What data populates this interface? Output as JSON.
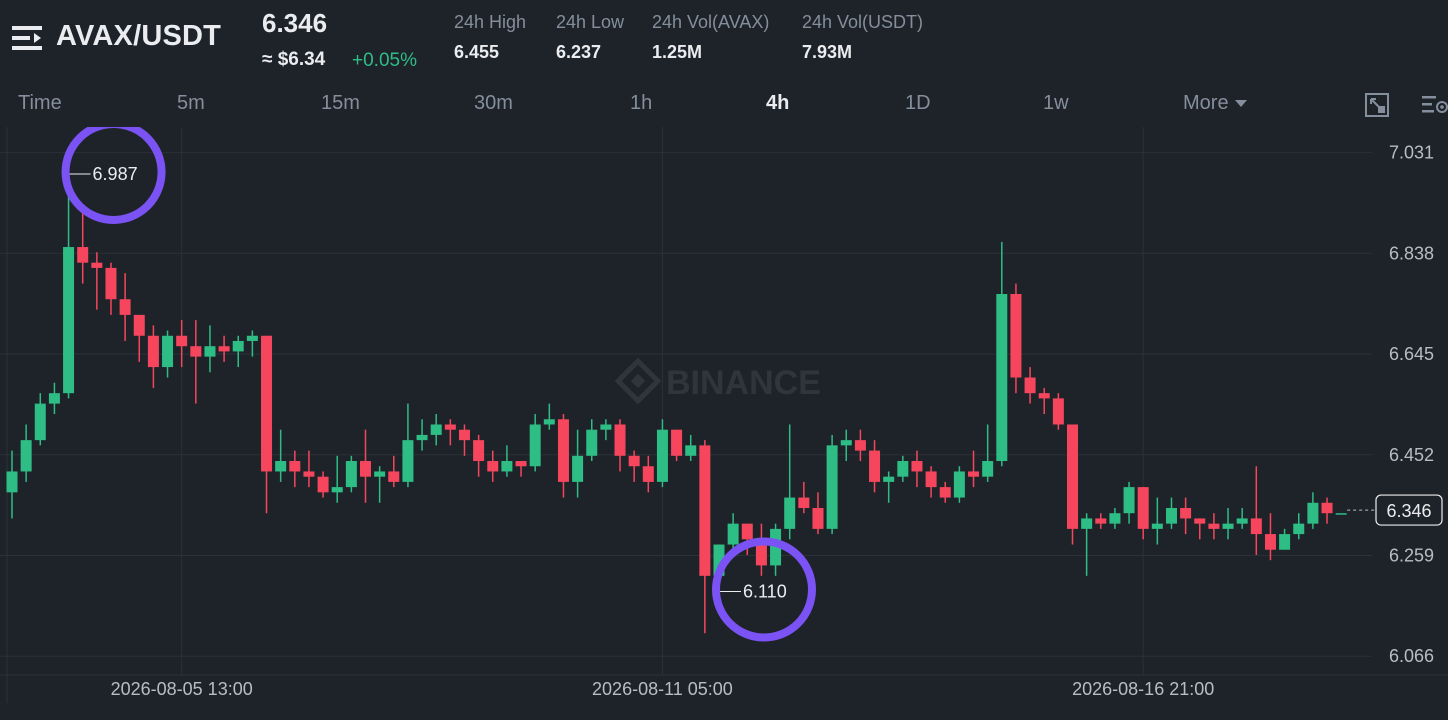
{
  "header": {
    "pair": "AVAX/USDT",
    "price": "6.346",
    "price_usd": "≈ $6.34",
    "change": "+0.05%",
    "stats": [
      {
        "label": "24h High",
        "value": "6.455"
      },
      {
        "label": "24h Low",
        "value": "6.237"
      },
      {
        "label": "24h Vol(AVAX)",
        "value": "1.25M"
      },
      {
        "label": "24h Vol(USDT)",
        "value": "7.93M"
      }
    ]
  },
  "timeframes": {
    "items": [
      "Time",
      "5m",
      "15m",
      "30m",
      "1h",
      "4h",
      "1D",
      "1w"
    ],
    "active": "4h",
    "more_label": "More"
  },
  "icons": [
    "menu-icon",
    "fullscreen-icon",
    "chart-settings-icon"
  ],
  "colors": {
    "up": "#2ebd85",
    "down": "#f6465d",
    "annotation": "#7b53f5",
    "background": "#1e2329"
  },
  "watermark": "BINANCE",
  "chart_data": {
    "type": "candlestick",
    "y_ticks": [
      "7.031",
      "6.838",
      "6.645",
      "6.452",
      "6.259",
      "6.066"
    ],
    "x_ticks": [
      "2026-08-05 13:00",
      "2026-08-11 05:00",
      "2026-08-16 21:00"
    ],
    "ylim": [
      6.03,
      7.08
    ],
    "last_price": "6.346",
    "annotations": [
      {
        "label": "6.987",
        "type": "high",
        "candle_index": 4
      },
      {
        "label": "6.110",
        "type": "low",
        "candle_index": 50
      }
    ],
    "candles": [
      [
        6.38,
        6.42,
        6.33,
        6.46
      ],
      [
        6.42,
        6.48,
        6.4,
        6.51
      ],
      [
        6.48,
        6.55,
        6.47,
        6.57
      ],
      [
        6.55,
        6.57,
        6.53,
        6.59
      ],
      [
        6.57,
        6.85,
        6.56,
        6.99
      ],
      [
        6.85,
        6.82,
        6.78,
        6.92
      ],
      [
        6.82,
        6.81,
        6.73,
        6.84
      ],
      [
        6.81,
        6.75,
        6.72,
        6.82
      ],
      [
        6.75,
        6.72,
        6.67,
        6.8
      ],
      [
        6.72,
        6.68,
        6.63,
        6.72
      ],
      [
        6.68,
        6.62,
        6.58,
        6.7
      ],
      [
        6.62,
        6.68,
        6.6,
        6.69
      ],
      [
        6.68,
        6.66,
        6.62,
        6.71
      ],
      [
        6.66,
        6.64,
        6.55,
        6.71
      ],
      [
        6.64,
        6.66,
        6.61,
        6.7
      ],
      [
        6.66,
        6.65,
        6.63,
        6.68
      ],
      [
        6.65,
        6.67,
        6.62,
        6.68
      ],
      [
        6.67,
        6.68,
        6.64,
        6.69
      ],
      [
        6.68,
        6.42,
        6.34,
        6.68
      ],
      [
        6.42,
        6.44,
        6.4,
        6.5
      ],
      [
        6.44,
        6.42,
        6.39,
        6.46
      ],
      [
        6.42,
        6.41,
        6.39,
        6.46
      ],
      [
        6.41,
        6.38,
        6.37,
        6.42
      ],
      [
        6.38,
        6.39,
        6.36,
        6.45
      ],
      [
        6.39,
        6.44,
        6.38,
        6.45
      ],
      [
        6.44,
        6.41,
        6.36,
        6.5
      ],
      [
        6.41,
        6.42,
        6.36,
        6.43
      ],
      [
        6.42,
        6.4,
        6.39,
        6.45
      ],
      [
        6.4,
        6.48,
        6.39,
        6.55
      ],
      [
        6.48,
        6.49,
        6.46,
        6.52
      ],
      [
        6.49,
        6.51,
        6.47,
        6.53
      ],
      [
        6.51,
        6.5,
        6.47,
        6.52
      ],
      [
        6.5,
        6.48,
        6.45,
        6.51
      ],
      [
        6.48,
        6.44,
        6.41,
        6.49
      ],
      [
        6.44,
        6.42,
        6.4,
        6.46
      ],
      [
        6.42,
        6.44,
        6.41,
        6.47
      ],
      [
        6.44,
        6.43,
        6.41,
        6.44
      ],
      [
        6.43,
        6.51,
        6.42,
        6.53
      ],
      [
        6.51,
        6.52,
        6.5,
        6.55
      ],
      [
        6.52,
        6.4,
        6.37,
        6.53
      ],
      [
        6.4,
        6.45,
        6.37,
        6.5
      ],
      [
        6.45,
        6.5,
        6.44,
        6.52
      ],
      [
        6.5,
        6.51,
        6.48,
        6.52
      ],
      [
        6.51,
        6.45,
        6.42,
        6.52
      ],
      [
        6.45,
        6.43,
        6.4,
        6.46
      ],
      [
        6.43,
        6.4,
        6.38,
        6.45
      ],
      [
        6.4,
        6.5,
        6.39,
        6.52
      ],
      [
        6.5,
        6.45,
        6.44,
        6.5
      ],
      [
        6.45,
        6.47,
        6.44,
        6.49
      ],
      [
        6.47,
        6.22,
        6.11,
        6.48
      ],
      [
        6.22,
        6.28,
        6.19,
        6.28
      ],
      [
        6.28,
        6.32,
        6.27,
        6.34
      ],
      [
        6.32,
        6.29,
        6.26,
        6.31
      ],
      [
        6.29,
        6.24,
        6.22,
        6.32
      ],
      [
        6.24,
        6.31,
        6.22,
        6.32
      ],
      [
        6.31,
        6.37,
        6.29,
        6.51
      ],
      [
        6.37,
        6.35,
        6.34,
        6.4
      ],
      [
        6.35,
        6.31,
        6.3,
        6.38
      ],
      [
        6.31,
        6.47,
        6.3,
        6.49
      ],
      [
        6.47,
        6.48,
        6.44,
        6.5
      ],
      [
        6.48,
        6.46,
        6.44,
        6.5
      ],
      [
        6.46,
        6.4,
        6.38,
        6.48
      ],
      [
        6.4,
        6.41,
        6.36,
        6.42
      ],
      [
        6.41,
        6.44,
        6.4,
        6.45
      ],
      [
        6.44,
        6.42,
        6.39,
        6.46
      ],
      [
        6.42,
        6.39,
        6.37,
        6.43
      ],
      [
        6.39,
        6.37,
        6.36,
        6.4
      ],
      [
        6.37,
        6.42,
        6.36,
        6.43
      ],
      [
        6.42,
        6.41,
        6.39,
        6.46
      ],
      [
        6.41,
        6.44,
        6.4,
        6.51
      ],
      [
        6.44,
        6.76,
        6.43,
        6.86
      ],
      [
        6.76,
        6.6,
        6.57,
        6.78
      ],
      [
        6.6,
        6.57,
        6.55,
        6.62
      ],
      [
        6.57,
        6.56,
        6.53,
        6.58
      ],
      [
        6.56,
        6.51,
        6.5,
        6.57
      ],
      [
        6.51,
        6.31,
        6.28,
        6.51
      ],
      [
        6.31,
        6.33,
        6.22,
        6.34
      ],
      [
        6.33,
        6.32,
        6.31,
        6.34
      ],
      [
        6.32,
        6.34,
        6.31,
        6.35
      ],
      [
        6.34,
        6.39,
        6.32,
        6.4
      ],
      [
        6.39,
        6.31,
        6.29,
        6.39
      ],
      [
        6.31,
        6.32,
        6.28,
        6.37
      ],
      [
        6.32,
        6.35,
        6.31,
        6.37
      ],
      [
        6.35,
        6.33,
        6.3,
        6.37
      ],
      [
        6.33,
        6.32,
        6.29,
        6.33
      ],
      [
        6.32,
        6.31,
        6.29,
        6.34
      ],
      [
        6.31,
        6.32,
        6.29,
        6.35
      ],
      [
        6.32,
        6.33,
        6.31,
        6.35
      ],
      [
        6.33,
        6.3,
        6.26,
        6.43
      ],
      [
        6.3,
        6.27,
        6.25,
        6.34
      ],
      [
        6.27,
        6.3,
        6.27,
        6.31
      ],
      [
        6.3,
        6.32,
        6.29,
        6.34
      ],
      [
        6.32,
        6.36,
        6.31,
        6.38
      ],
      [
        6.36,
        6.34,
        6.32,
        6.37
      ],
      [
        6.34,
        6.34,
        6.34,
        6.34
      ]
    ]
  }
}
